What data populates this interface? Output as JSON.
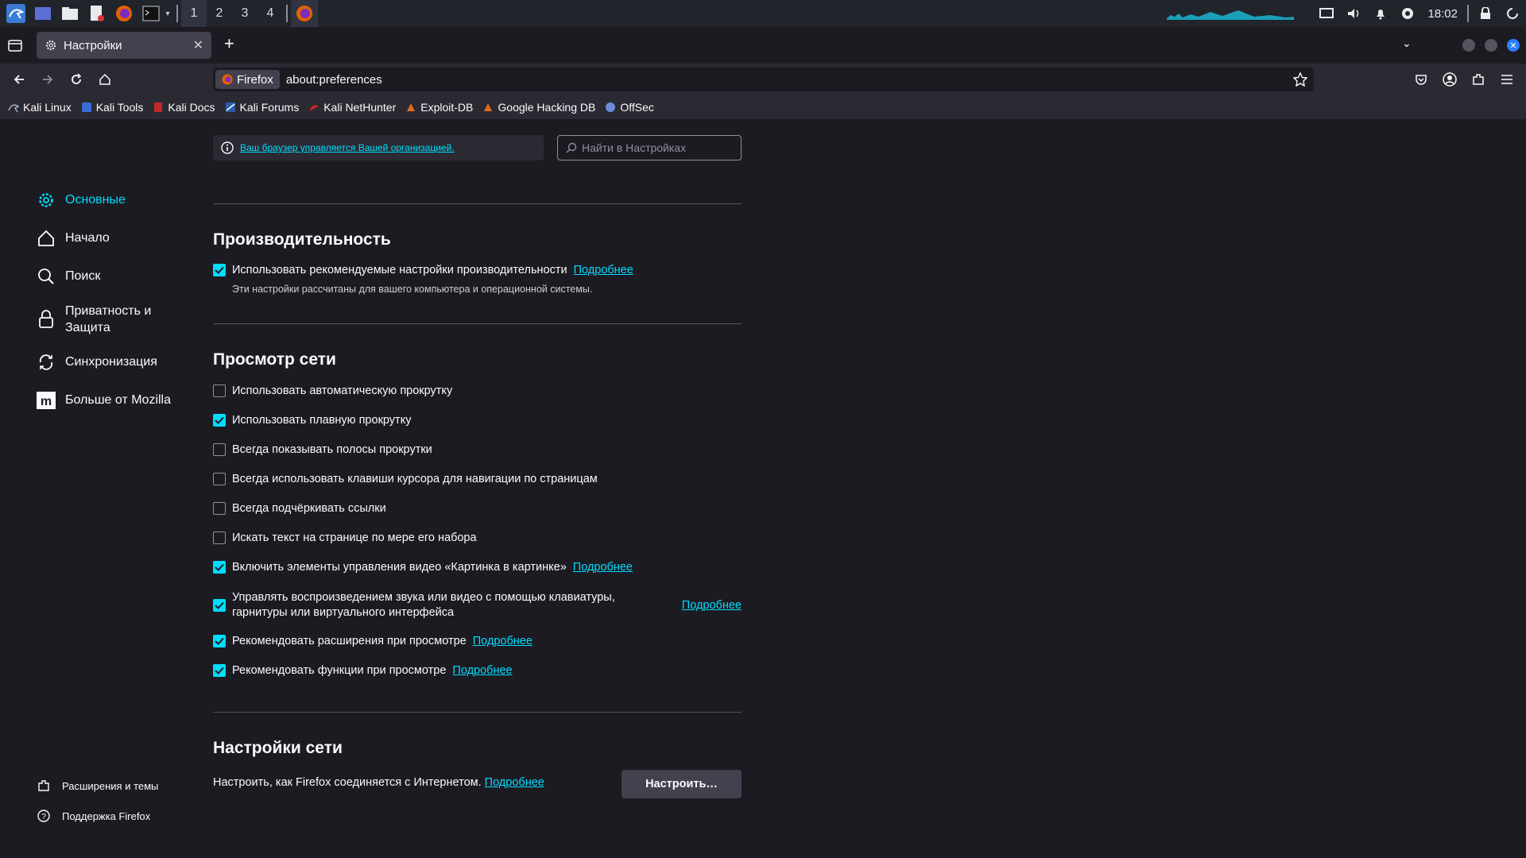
{
  "system": {
    "workspaces": [
      "1",
      "2",
      "3",
      "4"
    ],
    "time": "18:02"
  },
  "tab": {
    "title": "Настройки"
  },
  "nav": {
    "identity_label": "Firefox",
    "url": "about:preferences"
  },
  "bookmarks": [
    {
      "label": "Kali Linux",
      "color": "#2a5ea8"
    },
    {
      "label": "Kali Tools",
      "color": "#3a6cd8"
    },
    {
      "label": "Kali Docs",
      "color": "#c0292a"
    },
    {
      "label": "Kali Forums",
      "color": "#2a5ea8"
    },
    {
      "label": "Kali NetHunter",
      "color": "#c0292a"
    },
    {
      "label": "Exploit-DB",
      "color": "#e36b1d"
    },
    {
      "label": "Google Hacking DB",
      "color": "#e36b1d"
    },
    {
      "label": "OffSec",
      "color": "#6b8ad8"
    }
  ],
  "policy_notice": "Ваш браузер управляется Вашей организацией.",
  "search_placeholder": "Найти в Настройках",
  "sidebar": {
    "categories": [
      {
        "label": "Основные",
        "icon": "gear-icon",
        "selected": true
      },
      {
        "label": "Начало",
        "icon": "home-icon"
      },
      {
        "label": "Поиск",
        "icon": "search-icon"
      },
      {
        "label": "Приватность и\nЗащита",
        "icon": "lock-icon"
      },
      {
        "label": "Синхронизация",
        "icon": "sync-icon"
      },
      {
        "label": "Больше от Mozilla",
        "icon": "mozilla-icon"
      }
    ],
    "bottom": [
      {
        "label": "Расширения и темы",
        "icon": "puzzle-icon"
      },
      {
        "label": "Поддержка Firefox",
        "icon": "help-icon"
      }
    ]
  },
  "performance": {
    "heading": "Производительность",
    "checkbox_label": "Использовать рекомендуемые настройки производительности",
    "checked": true,
    "link": "Подробнее",
    "note": "Эти настройки рассчитаны для вашего компьютера и операционной системы."
  },
  "browsing": {
    "heading": "Просмотр сети",
    "items": [
      {
        "label": "Использовать автоматическую прокрутку",
        "checked": false
      },
      {
        "label": "Использовать плавную прокрутку",
        "checked": true
      },
      {
        "label": "Всегда показывать полосы прокрутки",
        "checked": false
      },
      {
        "label": "Всегда использовать клавиши курсора для навигации по страницам",
        "checked": false
      },
      {
        "label": "Всегда подчёркивать ссылки",
        "checked": false
      },
      {
        "label": "Искать текст на странице по мере его набора",
        "checked": false
      },
      {
        "label": "Включить элементы управления видео «Картинка в картинке»",
        "checked": true,
        "link": "Подробнее"
      },
      {
        "label": "Управлять воспроизведением звука или видео с помощью клавиатуры, гарнитуры или виртуального интерфейса",
        "checked": true,
        "link": "Подробнее"
      },
      {
        "label": "Рекомендовать расширения при просмотре",
        "checked": true,
        "link": "Подробнее"
      },
      {
        "label": "Рекомендовать функции при просмотре",
        "checked": true,
        "link": "Подробнее"
      }
    ]
  },
  "network": {
    "heading": "Настройки сети",
    "text": "Настроить, как Firefox соединяется с Интернетом.",
    "link": "Подробнее",
    "button": "Настроить…"
  },
  "colors": {
    "accent": "#00ddff",
    "bg": "#1c1b22",
    "toolbar": "#2b2a33"
  }
}
